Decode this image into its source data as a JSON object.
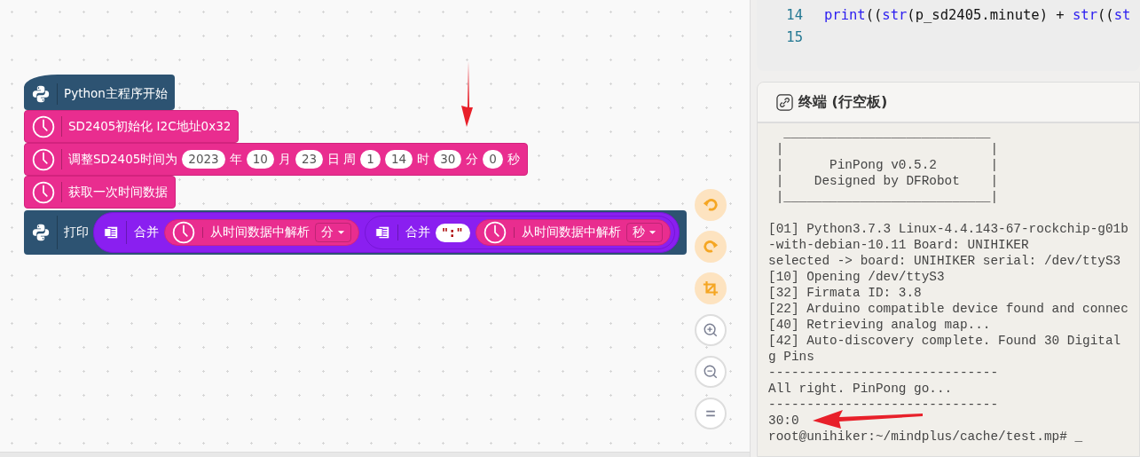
{
  "blocks": [
    {
      "kind": "start",
      "parts": [
        {
          "kind": "text",
          "text": "Python主程序开始"
        }
      ]
    },
    {
      "kind": "statement",
      "parts": [
        {
          "kind": "text",
          "text": "SD2405初始化 I2C地址0x32"
        }
      ]
    },
    {
      "kind": "statement",
      "parts": [
        {
          "kind": "text",
          "text": "调整SD2405时间为"
        },
        {
          "kind": "field",
          "text": "2023"
        },
        {
          "kind": "text",
          "text": "年"
        },
        {
          "kind": "field",
          "text": "10"
        },
        {
          "kind": "text",
          "text": "月"
        },
        {
          "kind": "field",
          "text": "23"
        },
        {
          "kind": "text",
          "text": "日 周"
        },
        {
          "kind": "field",
          "text": "1"
        },
        {
          "kind": "field",
          "text": "14"
        },
        {
          "kind": "text",
          "text": "时"
        },
        {
          "kind": "field",
          "text": "30"
        },
        {
          "kind": "text",
          "text": "分"
        },
        {
          "kind": "field",
          "text": "0"
        },
        {
          "kind": "text",
          "text": "秒"
        }
      ]
    },
    {
      "kind": "statement",
      "parts": [
        {
          "kind": "text",
          "text": "获取一次时间数据"
        }
      ]
    },
    {
      "kind": "print",
      "parts": [
        {
          "kind": "text",
          "text": "打印"
        },
        {
          "kind": "join",
          "text": "合并",
          "items": [
            {
              "kind": "parse",
              "text": "从时间数据中解析",
              "dropdown": "分"
            },
            {
              "kind": "join",
              "text": "合并",
              "items": [
                {
                  "kind": "string",
                  "text": "\":\""
                },
                {
                  "kind": "parse",
                  "text": "从时间数据中解析",
                  "dropdown": "秒"
                }
              ]
            }
          ]
        }
      ]
    }
  ],
  "code_editor": {
    "lines": [
      {
        "number": "14",
        "tokens": [
          {
            "kind": "builtin",
            "text": "print"
          },
          {
            "kind": "plain",
            "text": "(("
          },
          {
            "kind": "builtin",
            "text": "str"
          },
          {
            "kind": "plain",
            "text": "(p_sd2405.minute) + "
          },
          {
            "kind": "builtin",
            "text": "str"
          },
          {
            "kind": "plain",
            "text": "(("
          },
          {
            "kind": "builtin",
            "text": "st"
          }
        ]
      },
      {
        "number": "15"
      }
    ]
  },
  "terminal": {
    "title": "终端 (行空板)",
    "banner": [
      "  ___________________________",
      " |                           |",
      " |      PinPong v0.5.2       |",
      " |    Designed by DFRobot    |",
      " |___________________________|"
    ],
    "lines": [
      "[01] Python3.7.3 Linux-4.4.143-67-rockchip-g01b",
      "-with-debian-10.11 Board: UNIHIKER",
      "selected -> board: UNIHIKER serial: /dev/ttyS3",
      "[10] Opening /dev/ttyS3",
      "[32] Firmata ID: 3.8",
      "[22] Arduino compatible device found and connec",
      "[40] Retrieving analog map...",
      "[42] Auto-discovery complete. Found 30 Digital",
      "g Pins",
      "------------------------------",
      "All right. PinPong go...",
      "------------------------------",
      "30:0",
      "root@unihiker:~/mindplus/cache/test.mp# _"
    ]
  }
}
